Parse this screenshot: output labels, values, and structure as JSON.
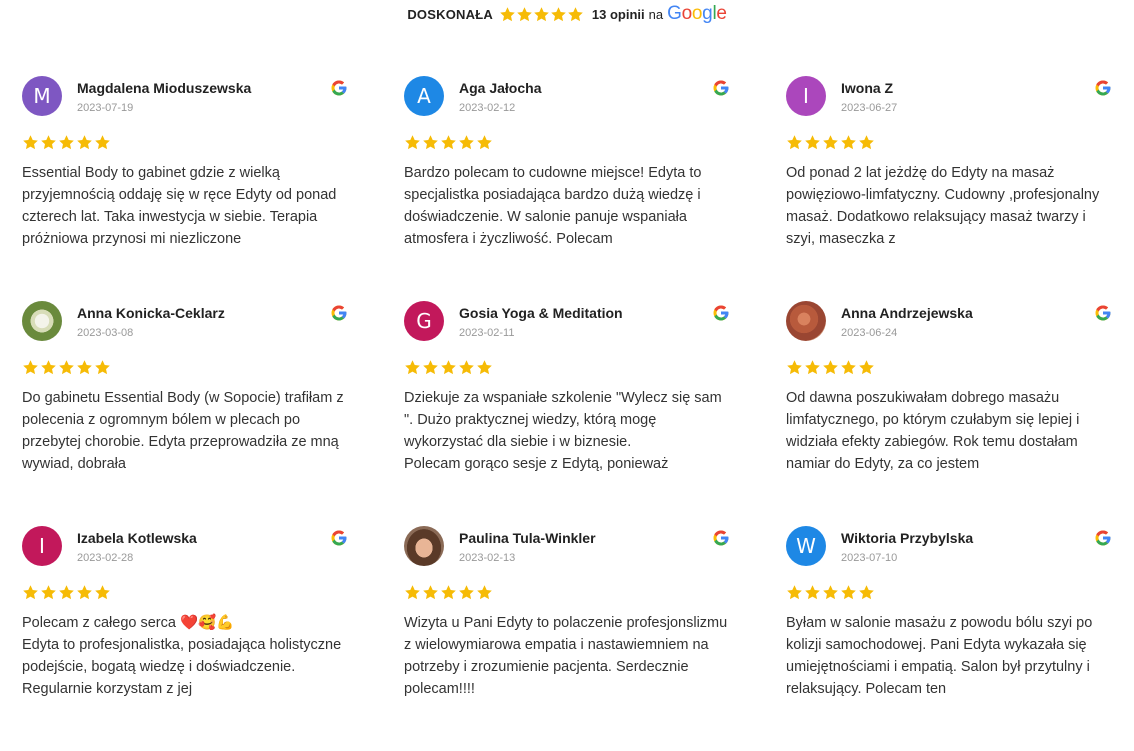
{
  "summary": {
    "rating_word": "DOSKONAŁA",
    "stars": 5,
    "count_text": "13 opinii",
    "on_text": "na",
    "brand": "Google"
  },
  "colors": {
    "star": "#f6bb06",
    "g_blue": "#4285F4",
    "g_red": "#EA4335",
    "g_yellow": "#FBBC05",
    "g_green": "#34A853"
  },
  "reviews": [
    {
      "name": "Magdalena Mioduszewska",
      "date": "2023-07-19",
      "initial": "M",
      "avatar_color": "#7e57c2",
      "avatar_kind": "initial",
      "stars": 5,
      "text": "Essential Body to gabinet gdzie z wielką przyjemnością oddaję się w ręce Edyty od ponad czterech lat. Taka inwestycja w siebie. Terapia próżniowa przynosi mi niezliczone"
    },
    {
      "name": "Aga Jałocha",
      "date": "2023-02-12",
      "initial": "A",
      "avatar_color": "#1e88e5",
      "avatar_kind": "initial",
      "stars": 5,
      "text": "Bardzo polecam to cudowne miejsce! Edyta to specjalistka posiadająca bardzo dużą wiedzę i doświadczenie. W salonie panuje wspaniała atmosfera i życzliwość. Polecam"
    },
    {
      "name": "Iwona Z",
      "date": "2023-06-27",
      "initial": "I",
      "avatar_color": "#ab47bc",
      "avatar_kind": "initial",
      "stars": 5,
      "text": "Od ponad 2 lat jeżdżę do Edyty na masaż powięziowo-limfatyczny. Cudowny ,profesjonalny masaż. Dodatkowo relaksujący masaż twarzy i szyi, maseczka z"
    },
    {
      "name": "Anna Konicka-Ceklarz",
      "date": "2023-03-08",
      "initial": "",
      "avatar_color": "#6a8a3c",
      "avatar_kind": "photo-flower",
      "stars": 5,
      "text": "Do gabinetu Essential Body (w Sopocie) trafiłam z polecenia z ogromnym bólem w plecach po przebytej chorobie. Edyta przeprowadziła ze mną wywiad, dobrała"
    },
    {
      "name": "Gosia Yoga & Meditation",
      "date": "2023-02-11",
      "initial": "G",
      "avatar_color": "#c2185b",
      "avatar_kind": "initial",
      "stars": 5,
      "text": "Dziekuje za wspaniałe szkolenie \"Wylecz się sam \". Dużo praktycznej wiedzy, którą mogę wykorzystać dla siebie i w biznesie.\nPolecam gorąco sesje z Edytą, ponieważ"
    },
    {
      "name": "Anna Andrzejewska",
      "date": "2023-06-24",
      "initial": "",
      "avatar_color": "#b85a3c",
      "avatar_kind": "photo-cake",
      "stars": 5,
      "text": "Od dawna poszukiwałam dobrego masażu limfatycznego, po którym czułabym się lepiej i widziała efekty zabiegów. Rok temu dostałam namiar do Edyty, za co jestem"
    },
    {
      "name": "Izabela Kotlewska",
      "date": "2023-02-28",
      "initial": "I",
      "avatar_color": "#c2185b",
      "avatar_kind": "initial",
      "stars": 5,
      "text": "Polecam z całego serca ❤️🥰💪\nEdyta to profesjonalistka, posiadająca holistyczne podejście, bogatą wiedzę i doświadczenie. Regularnie korzystam z jej"
    },
    {
      "name": "Paulina Tula-Winkler",
      "date": "2023-02-13",
      "initial": "",
      "avatar_color": "#8a6a56",
      "avatar_kind": "photo-woman",
      "stars": 5,
      "text": "Wizyta u Pani Edyty to polaczenie profesjonslizmu z wielowymiarowa empatia i nastawiemniem na potrzeby i zrozumienie pacjenta. Serdecznie polecam!!!!"
    },
    {
      "name": "Wiktoria Przybylska",
      "date": "2023-07-10",
      "initial": "W",
      "avatar_color": "#1e88e5",
      "avatar_kind": "initial",
      "stars": 5,
      "text": "Byłam w salonie masażu z powodu bólu szyi po kolizji samochodowej. Pani Edyta wykazała się umiejętnościami i empatią. Salon był przytulny i relaksujący. Polecam ten"
    }
  ]
}
